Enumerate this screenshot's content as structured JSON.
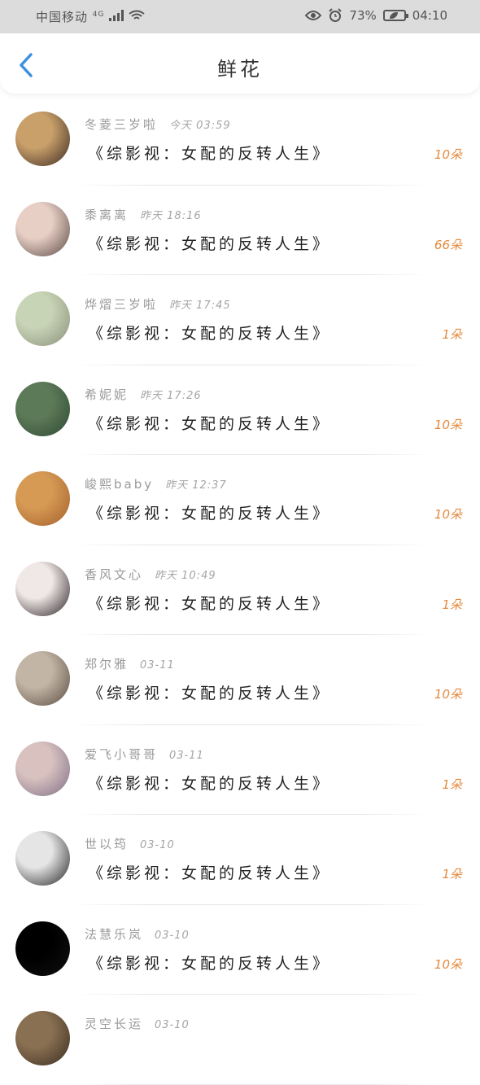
{
  "status_bar": {
    "carrier": "中国移动",
    "network": "4G",
    "battery": "73%",
    "time": "04:10"
  },
  "header": {
    "title": "鲜花",
    "back_icon": "chevron-left-icon"
  },
  "colors": {
    "accent": "#3d8fe0",
    "count": "#e58a3c"
  },
  "items": [
    {
      "name": "冬菱三岁啦",
      "time": "今天  03:59",
      "book": "《综影视：女配的反转人生》",
      "count": "10朵",
      "avatar_colors": [
        "#c9a06a",
        "#3b2a22"
      ]
    },
    {
      "name": "黍离离",
      "time": "昨天  18:16",
      "book": "《综影视：女配的反转人生》",
      "count": "66朵",
      "avatar_colors": [
        "#e8cfc6",
        "#5a4a44"
      ]
    },
    {
      "name": "烨熠三岁啦",
      "time": "昨天  17:45",
      "book": "《综影视：女配的反转人生》",
      "count": "1朵",
      "avatar_colors": [
        "#c8d4b6",
        "#8a8f7a"
      ]
    },
    {
      "name": "希妮妮",
      "time": "昨天  17:26",
      "book": "《综影视：女配的反转人生》",
      "count": "10朵",
      "avatar_colors": [
        "#5d7a58",
        "#2f4a33"
      ]
    },
    {
      "name": "峻熙baby",
      "time": "昨天  12:37",
      "book": "《综影视：女配的反转人生》",
      "count": "10朵",
      "avatar_colors": [
        "#d69a55",
        "#a45f2a"
      ]
    },
    {
      "name": "香风文心",
      "time": "昨天  10:49",
      "book": "《综影视：女配的反转人生》",
      "count": "1朵",
      "avatar_colors": [
        "#f0e8e6",
        "#2a2224"
      ]
    },
    {
      "name": "郑尔雅",
      "time": "03-11",
      "book": "《综影视：女配的反转人生》",
      "count": "10朵",
      "avatar_colors": [
        "#c3b5a6",
        "#5a4c40"
      ]
    },
    {
      "name": "爱飞小哥哥",
      "time": "03-11",
      "book": "《综影视：女配的反转人生》",
      "count": "1朵",
      "avatar_colors": [
        "#d8c1bf",
        "#7f6f86"
      ]
    },
    {
      "name": "世以筠",
      "time": "03-10",
      "book": "《综影视：女配的反转人生》",
      "count": "1朵",
      "avatar_colors": [
        "#e5e5e5",
        "#222222"
      ]
    },
    {
      "name": "法慧乐岚",
      "time": "03-10",
      "book": "《综影视：女配的反转人生》",
      "count": "10朵",
      "avatar_colors": [
        "#000000",
        "#111111"
      ]
    },
    {
      "name": "灵空长运",
      "time": "03-10",
      "book": "",
      "count": "",
      "avatar_colors": [
        "#8a7052",
        "#3a2d20"
      ]
    }
  ]
}
